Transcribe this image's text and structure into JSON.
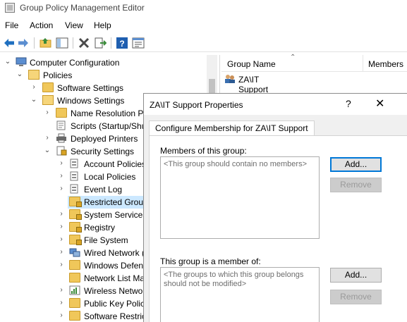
{
  "app": {
    "title": "Group Policy Management Editor"
  },
  "menu": [
    "File",
    "Action",
    "View",
    "Help"
  ],
  "toolbar": {
    "icons": [
      "back-arrow-icon",
      "forward-arrow-icon",
      "up-folder-icon",
      "show-hide-tree-icon",
      "delete-icon",
      "export-list-icon",
      "help-icon",
      "properties-icon"
    ],
    "colors": {
      "blue": "#1f6fc0",
      "green": "#3a8a3a",
      "gray": "#5a5a5a"
    }
  },
  "tree": {
    "items": [
      {
        "label": "Computer Configuration",
        "expander": "open",
        "icon": "computer"
      },
      {
        "label": "Policies",
        "expander": "open",
        "icon": "folder-open"
      },
      {
        "label": "Software Settings",
        "expander": "closed",
        "icon": "folder"
      },
      {
        "label": "Windows Settings",
        "expander": "open",
        "icon": "folder-open"
      },
      {
        "label": "Name Resolution Po",
        "expander": "closed",
        "icon": "folder"
      },
      {
        "label": "Scripts (Startup/Shu",
        "expander": "none",
        "icon": "script"
      },
      {
        "label": "Deployed Printers",
        "expander": "closed",
        "icon": "printer"
      },
      {
        "label": "Security Settings",
        "expander": "open",
        "icon": "security"
      },
      {
        "label": "Account Policies",
        "expander": "closed",
        "icon": "policy"
      },
      {
        "label": "Local Policies",
        "expander": "closed",
        "icon": "policy"
      },
      {
        "label": "Event Log",
        "expander": "closed",
        "icon": "policy"
      },
      {
        "label": "Restricted Group",
        "expander": "none",
        "icon": "folder-lock",
        "selected": true
      },
      {
        "label": "System Services",
        "expander": "closed",
        "icon": "folder-lock"
      },
      {
        "label": "Registry",
        "expander": "closed",
        "icon": "folder-lock"
      },
      {
        "label": "File System",
        "expander": "closed",
        "icon": "folder-lock"
      },
      {
        "label": "Wired Network (",
        "expander": "closed",
        "icon": "network"
      },
      {
        "label": "Windows Defend",
        "expander": "closed",
        "icon": "folder"
      },
      {
        "label": "Network List Ma",
        "expander": "none",
        "icon": "folder"
      },
      {
        "label": "Wireless Networ",
        "expander": "closed",
        "icon": "chart"
      },
      {
        "label": "Public Key Polic",
        "expander": "closed",
        "icon": "folder"
      },
      {
        "label": "Software Restric",
        "expander": "closed",
        "icon": "folder"
      }
    ]
  },
  "list": {
    "columns": [
      "Group Name",
      "Members"
    ],
    "rows": [
      {
        "name": "ZA\\IT Support"
      }
    ]
  },
  "dialog": {
    "title": "ZA\\IT Support Properties",
    "help": "?",
    "close": "✕",
    "tab": "Configure Membership for ZA\\IT Support",
    "members_label": "Members of this group:",
    "members_placeholder": "<This group should contain no members>",
    "memberof_label": "This group is a member of:",
    "memberof_placeholder": "<The groups to which this group belongs should not be modified>",
    "add_label": "Add...",
    "remove_label": "Remove"
  },
  "colors": {
    "selection": "#cce8ff",
    "accent": "#0078d7",
    "folder": "#f0c75a"
  }
}
